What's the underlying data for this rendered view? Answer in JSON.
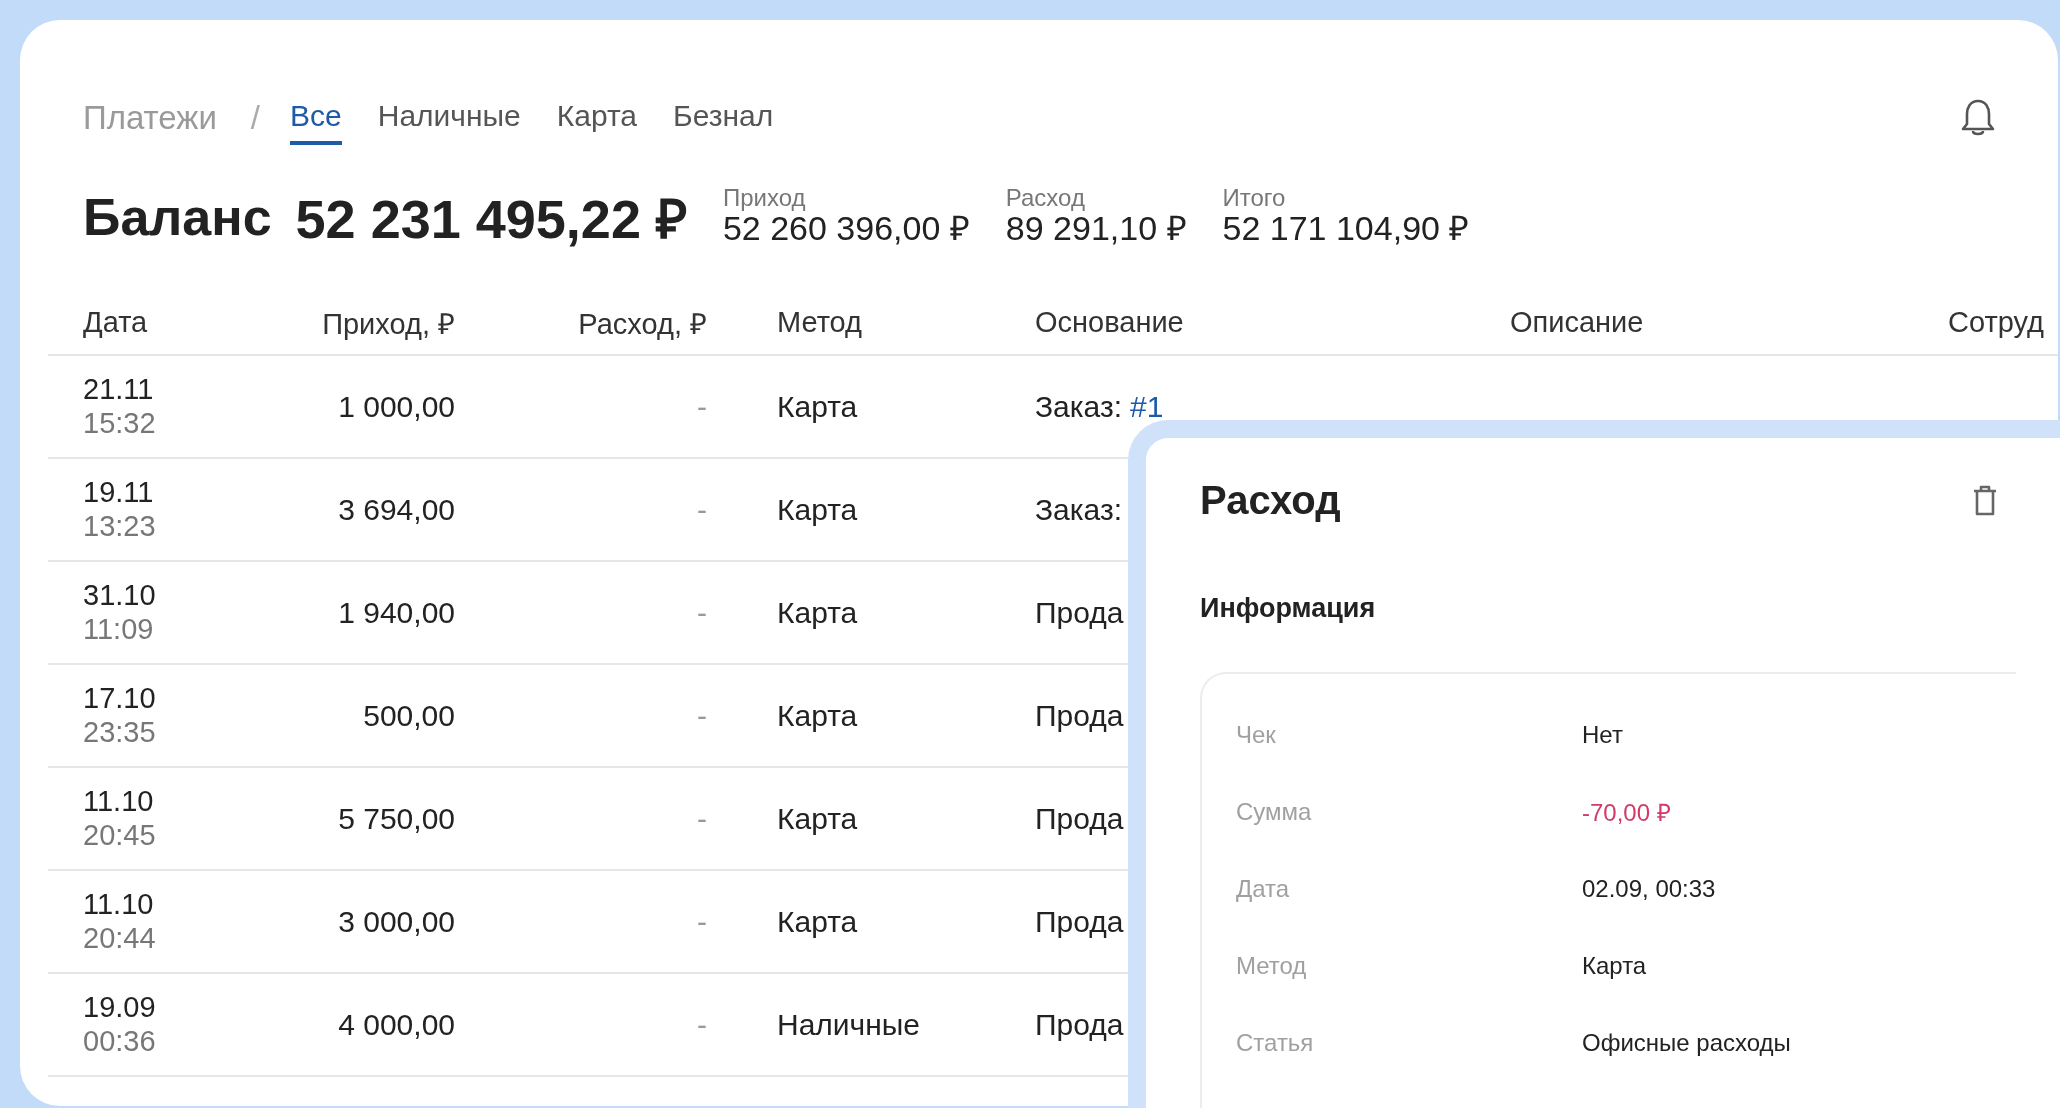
{
  "header": {
    "breadcrumb": "Платежи",
    "separator": "/",
    "tabs": [
      {
        "label": "Все",
        "selected": true
      },
      {
        "label": "Наличные",
        "selected": false
      },
      {
        "label": "Карта",
        "selected": false
      },
      {
        "label": "Безнал",
        "selected": false
      }
    ]
  },
  "balance": {
    "label": "Баланс",
    "value": "52 231 495,22 ₽",
    "totals": [
      {
        "label": "Приход",
        "value": "52 260 396,00 ₽"
      },
      {
        "label": "Расход",
        "value": "89 291,10 ₽"
      },
      {
        "label": "Итого",
        "value": "52 171 104,90 ₽"
      }
    ]
  },
  "table": {
    "columns": [
      "Дата",
      "Приход, ₽",
      "Расход, ₽",
      "Метод",
      "Основание",
      "Описание",
      "Сотруд"
    ],
    "rows": [
      {
        "date": "21.11",
        "time": "15:32",
        "income": "1 000,00",
        "expense": "-",
        "method": "Карта",
        "basis": "Заказ:",
        "basis_link": "#1"
      },
      {
        "date": "19.11",
        "time": "13:23",
        "income": "3 694,00",
        "expense": "-",
        "method": "Карта",
        "basis": "Заказ:"
      },
      {
        "date": "31.10",
        "time": "11:09",
        "income": "1 940,00",
        "expense": "-",
        "method": "Карта",
        "basis": "Прода"
      },
      {
        "date": "17.10",
        "time": "23:35",
        "income": "500,00",
        "expense": "-",
        "method": "Карта",
        "basis": "Прода"
      },
      {
        "date": "11.10",
        "time": "20:45",
        "income": "5 750,00",
        "expense": "-",
        "method": "Карта",
        "basis": "Прода"
      },
      {
        "date": "11.10",
        "time": "20:44",
        "income": "3 000,00",
        "expense": "-",
        "method": "Карта",
        "basis": "Прода"
      },
      {
        "date": "19.09",
        "time": "00:36",
        "income": "4 000,00",
        "expense": "-",
        "method": "Наличные",
        "basis": "Прода"
      }
    ]
  },
  "panel": {
    "title": "Расход",
    "section": "Информация",
    "fields": [
      {
        "label": "Чек",
        "value": "Нет",
        "kind": "plain"
      },
      {
        "label": "Сумма",
        "value": "-70,00 ₽",
        "kind": "negative"
      },
      {
        "label": "Дата",
        "value": "02.09, 00:33",
        "kind": "plain"
      },
      {
        "label": "Метод",
        "value": "Карта",
        "kind": "plain"
      },
      {
        "label": "Статья",
        "value": "Офисные расходы",
        "kind": "plain"
      }
    ]
  }
}
